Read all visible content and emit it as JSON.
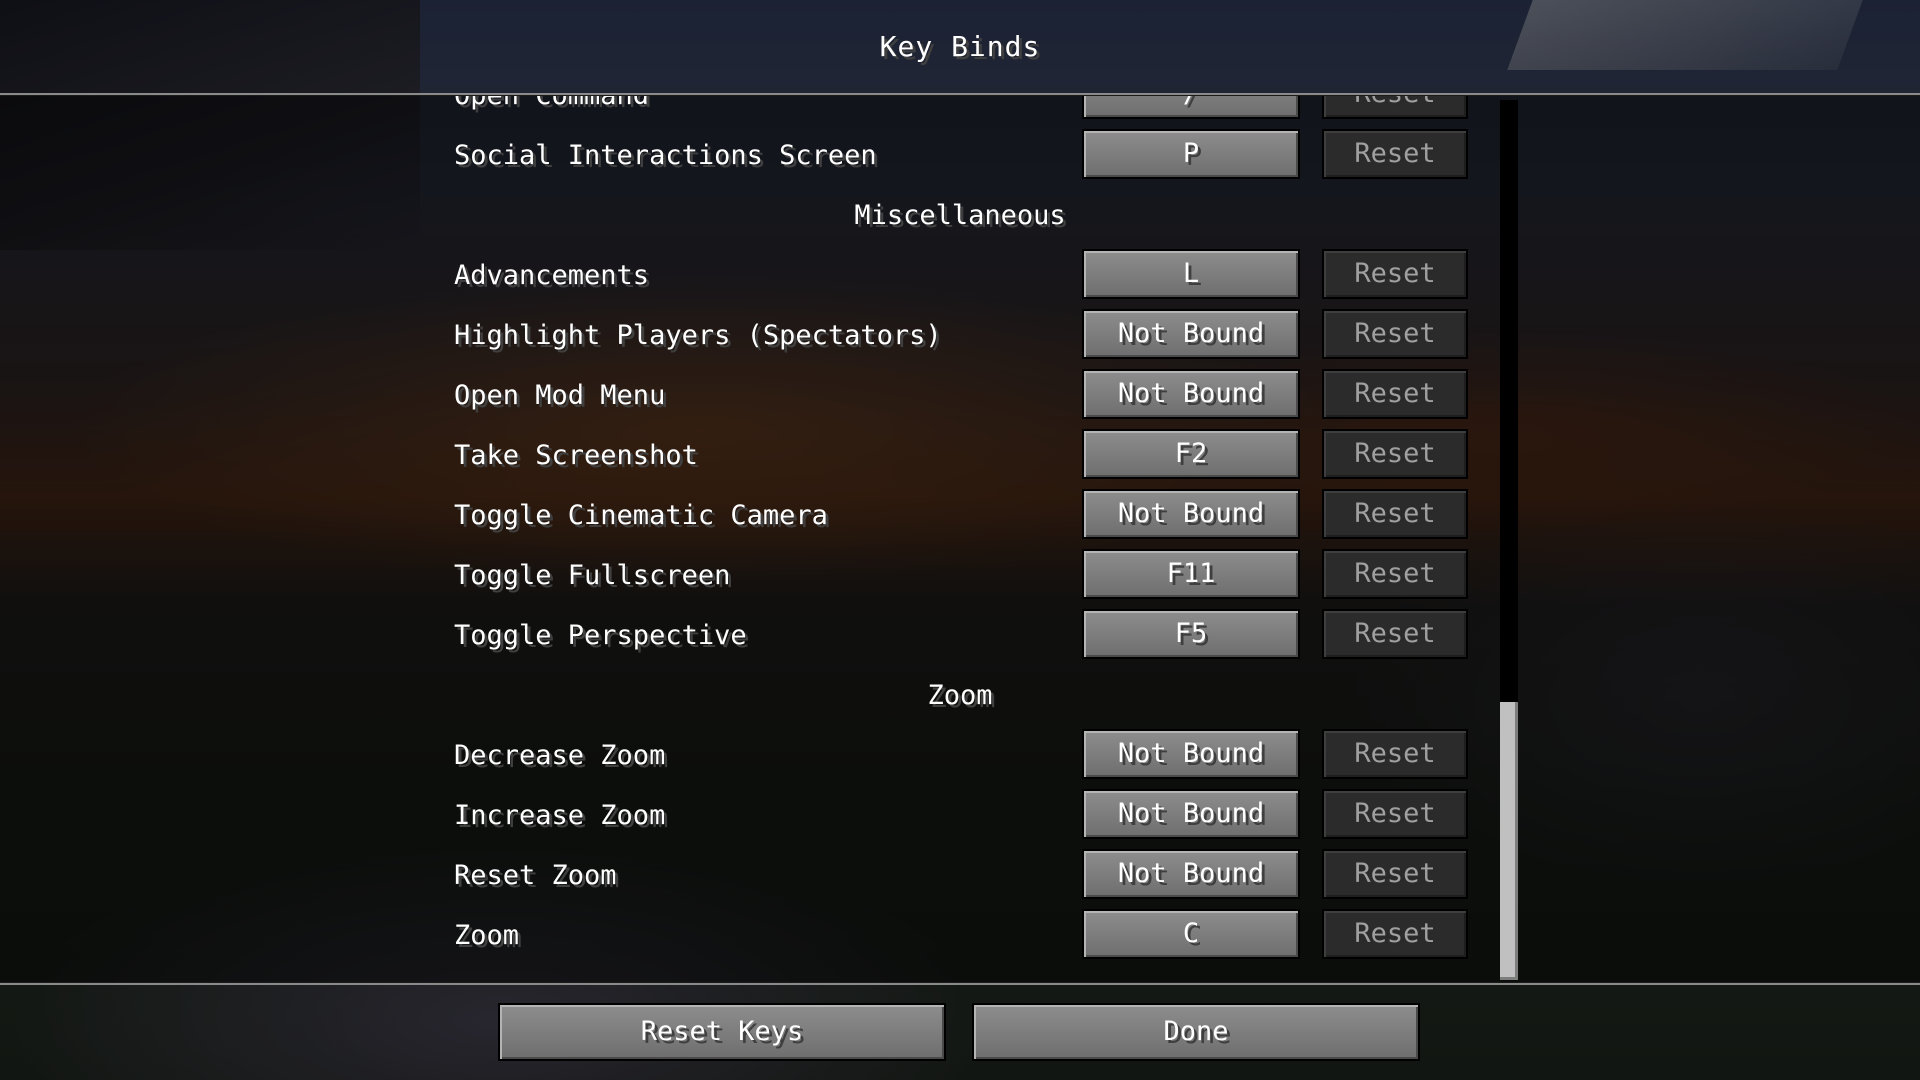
{
  "screen": {
    "title": "Key Binds"
  },
  "list": {
    "rows": [
      {
        "type": "binding",
        "action": "Open Command",
        "key": "/",
        "reset": "Reset"
      },
      {
        "type": "binding",
        "action": "Social Interactions Screen",
        "key": "P",
        "reset": "Reset"
      },
      {
        "type": "category",
        "label": "Miscellaneous"
      },
      {
        "type": "binding",
        "action": "Advancements",
        "key": "L",
        "reset": "Reset"
      },
      {
        "type": "binding",
        "action": "Highlight Players (Spectators)",
        "key": "Not Bound",
        "reset": "Reset"
      },
      {
        "type": "binding",
        "action": "Open Mod Menu",
        "key": "Not Bound",
        "reset": "Reset"
      },
      {
        "type": "binding",
        "action": "Take Screenshot",
        "key": "F2",
        "reset": "Reset"
      },
      {
        "type": "binding",
        "action": "Toggle Cinematic Camera",
        "key": "Not Bound",
        "reset": "Reset"
      },
      {
        "type": "binding",
        "action": "Toggle Fullscreen",
        "key": "F11",
        "reset": "Reset"
      },
      {
        "type": "binding",
        "action": "Toggle Perspective",
        "key": "F5",
        "reset": "Reset"
      },
      {
        "type": "category",
        "label": "Zoom"
      },
      {
        "type": "binding",
        "action": "Decrease Zoom",
        "key": "Not Bound",
        "reset": "Reset"
      },
      {
        "type": "binding",
        "action": "Increase Zoom",
        "key": "Not Bound",
        "reset": "Reset"
      },
      {
        "type": "binding",
        "action": "Reset Zoom",
        "key": "Not Bound",
        "reset": "Reset"
      },
      {
        "type": "binding",
        "action": "Zoom",
        "key": "C",
        "reset": "Reset"
      }
    ]
  },
  "scrollbar": {
    "position": "bottom"
  },
  "footer": {
    "reset_keys_label": "Reset Keys",
    "done_label": "Done"
  }
}
